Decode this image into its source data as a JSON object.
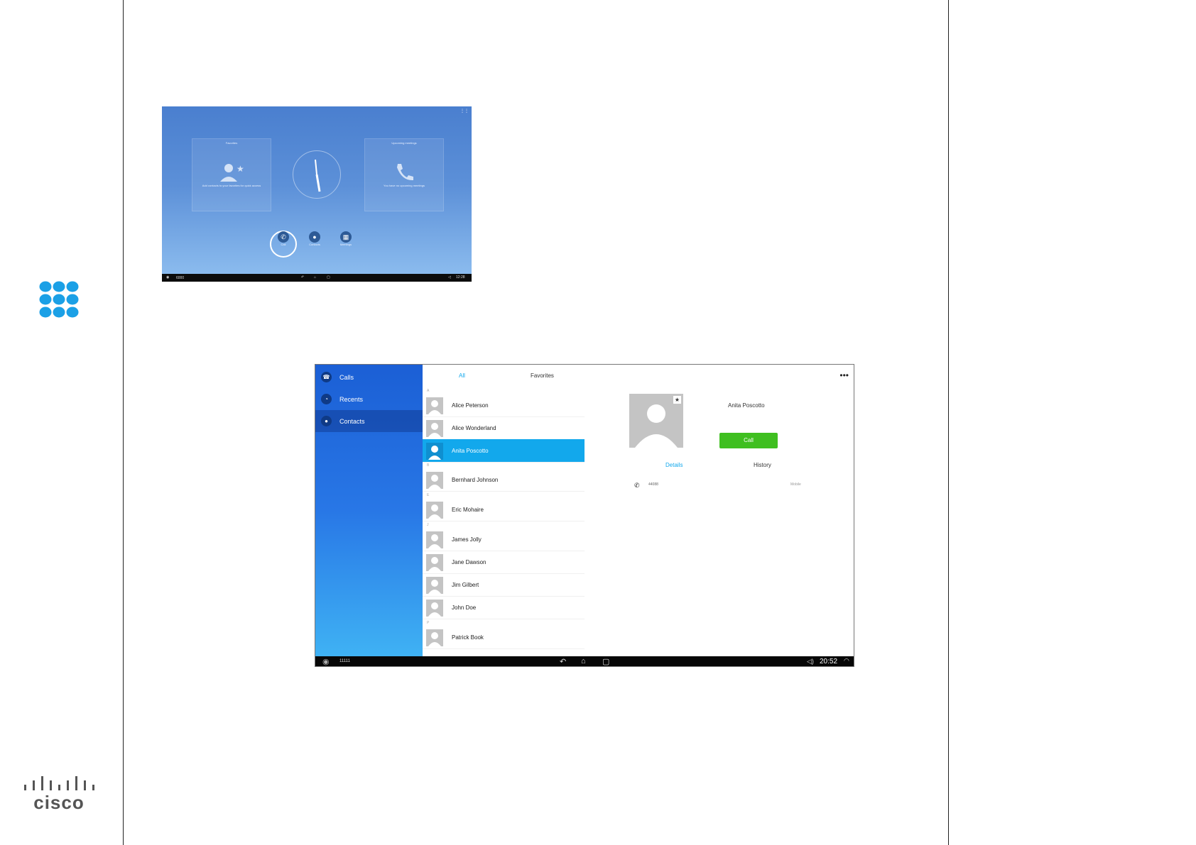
{
  "home_screen": {
    "menu": "⋮⋮",
    "tile_left": {
      "title": "Favorites",
      "desc": "Add contacts to your favorites for quick access"
    },
    "tile_right": {
      "title": "Upcoming meetings",
      "desc": "You have no upcoming meetings"
    },
    "buttons": [
      {
        "label": "Call",
        "icon": "phone-icon"
      },
      {
        "label": "Contacts",
        "icon": "person-icon"
      },
      {
        "label": "Meetings",
        "icon": "calendar-icon"
      }
    ],
    "statusbar": {
      "ext": "6000",
      "time": "12:28"
    }
  },
  "contacts_app": {
    "sidebar": [
      {
        "label": "Calls",
        "icon": "handset-icon"
      },
      {
        "label": "Recents",
        "icon": "clock-icon"
      },
      {
        "label": "Contacts",
        "icon": "person-icon"
      }
    ],
    "tabs": {
      "all": "All",
      "favorites": "Favorites"
    },
    "letters": [
      "A",
      "B",
      "E",
      "J",
      "P"
    ],
    "contacts": [
      {
        "name": "Alice Peterson"
      },
      {
        "name": "Alice Wonderland"
      },
      {
        "name": "Anita Poscotto"
      },
      {
        "name": "Bernhard Johnson"
      },
      {
        "name": "Eric Mohaire"
      },
      {
        "name": "James Jolly"
      },
      {
        "name": "Jane Dawson"
      },
      {
        "name": "Jim Gilbert"
      },
      {
        "name": "John Doe"
      },
      {
        "name": "Patrick Book"
      }
    ],
    "detail": {
      "name": "Anita Poscotto",
      "call_label": "Call",
      "tab_details": "Details",
      "tab_history": "History",
      "number": "44088",
      "number_type": "Mobile"
    },
    "statusbar": {
      "ext": "11111",
      "time": "20:52"
    }
  },
  "colors": {
    "accent": "#12a8ec",
    "call_green": "#3fbf20",
    "grid_icon": "#1ba0e6"
  }
}
